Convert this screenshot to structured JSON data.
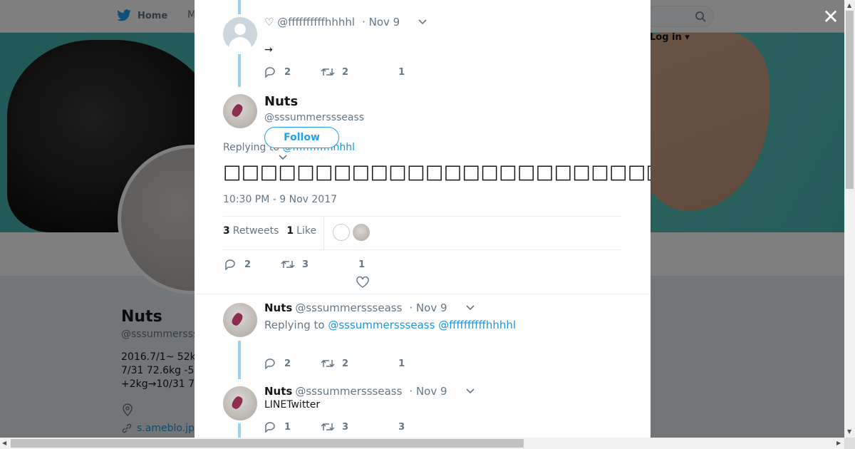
{
  "nav": {
    "home_label": "Home",
    "next_label": "M",
    "login_label": "Log in"
  },
  "background_profile": {
    "name": "Nuts",
    "handle": "@sssummerssseass",
    "bio_lines": [
      "2016.7/1~ 52k",
      "7/31 72.6kg -5",
      "+2kg→10/31 7"
    ],
    "link": "s.ameblo.jp"
  },
  "thread": {
    "prev_tweet": {
      "handle": "♡ @ffffffffffhhhhl",
      "date": "· Nov 9",
      "text": "→",
      "replies": "2",
      "retweets": "2",
      "likes": "1"
    },
    "main_tweet": {
      "name": "Nuts",
      "handle": "@sssummerssseass",
      "follow_label": "Follow",
      "replying_prefix": "Replying to ",
      "replying_handle": "@ffffffffffhhhhl",
      "text": "□□□□□□□□□□□□□□□□□□□□□□□□□□□□□□□□□□□□□□□□□□□□□□□□□□LINE□□□□",
      "timestamp": "10:30 PM - 9 Nov 2017",
      "retweets_count": "3",
      "retweets_label": "Retweets",
      "likes_count": "1",
      "likes_label": "Like",
      "replies": "2",
      "retweets": "3",
      "likes": "1"
    },
    "reply_1": {
      "name": "Nuts",
      "handle": "@sssummerssseass",
      "date": "· Nov 9",
      "replying_prefix": "Replying to ",
      "replying_handles": "@sssummerssseass @ffffffffffhhhhl",
      "replies": "2",
      "retweets": "2",
      "likes": "1"
    },
    "reply_2": {
      "name": "Nuts",
      "handle": "@sssummerssseass",
      "date": "· Nov 9",
      "text": "LINETwitter",
      "replies": "1",
      "retweets": "3",
      "likes": "3"
    }
  },
  "close_icon": "close-icon",
  "colors": {
    "accent": "#1da1f2",
    "thread_line": "#9ad2f0",
    "muted": "#657786"
  }
}
